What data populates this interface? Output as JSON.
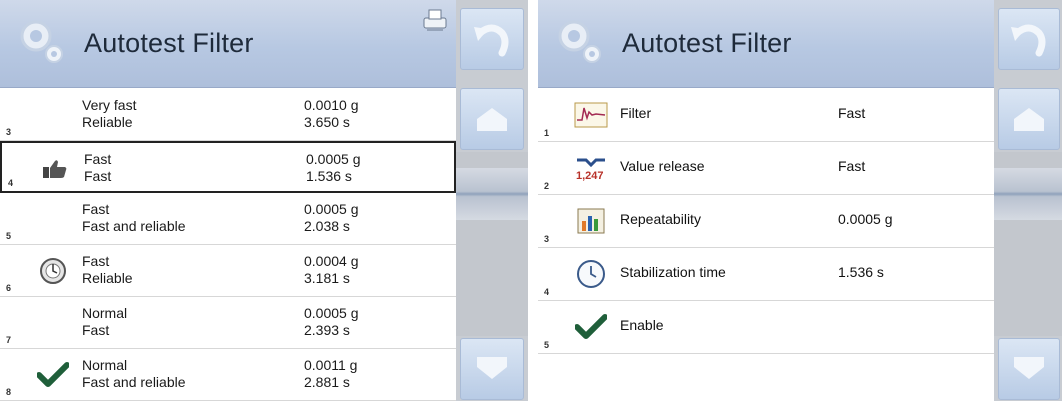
{
  "left_panel": {
    "title": "Autotest Filter",
    "rows": [
      {
        "num": "3",
        "label1": "Very fast",
        "label2": "Reliable",
        "val1": "0.0010 g",
        "val2": "3.650 s",
        "icon": ""
      },
      {
        "num": "4",
        "label1": "Fast",
        "label2": "Fast",
        "val1": "0.0005 g",
        "val2": "1.536 s",
        "icon": "thumbs-up-icon"
      },
      {
        "num": "5",
        "label1": "Fast",
        "label2": "Fast and reliable",
        "val1": "0.0005 g",
        "val2": "2.038 s",
        "icon": ""
      },
      {
        "num": "6",
        "label1": "Fast",
        "label2": "Reliable",
        "val1": "0.0004 g",
        "val2": "3.181 s",
        "icon": "reliable-dial-icon"
      },
      {
        "num": "7",
        "label1": "Normal",
        "label2": "Fast",
        "val1": "0.0005 g",
        "val2": "2.393 s",
        "icon": ""
      },
      {
        "num": "8",
        "label1": "Normal",
        "label2": "Fast and reliable",
        "val1": "0.0011 g",
        "val2": "2.881 s",
        "icon": "checkmark-icon"
      }
    ]
  },
  "right_panel": {
    "title": "Autotest Filter",
    "rows": [
      {
        "num": "1",
        "label": "Filter",
        "value": "Fast",
        "icon": "filter-icon"
      },
      {
        "num": "2",
        "label": "Value release",
        "value": "Fast",
        "icon": "value-release-icon",
        "icon_text": "1,247"
      },
      {
        "num": "3",
        "label": "Repeatability",
        "value": "0.0005 g",
        "icon": "repeatability-icon"
      },
      {
        "num": "4",
        "label": "Stabilization time",
        "value": "1.536 s",
        "icon": "clock-icon"
      },
      {
        "num": "5",
        "label": "Enable",
        "value": "",
        "icon": "checkmark-icon"
      }
    ]
  },
  "colors": {
    "header": "#b7c8e2",
    "sidebar": "#c8ccd2",
    "check": "#1f5f3a"
  }
}
